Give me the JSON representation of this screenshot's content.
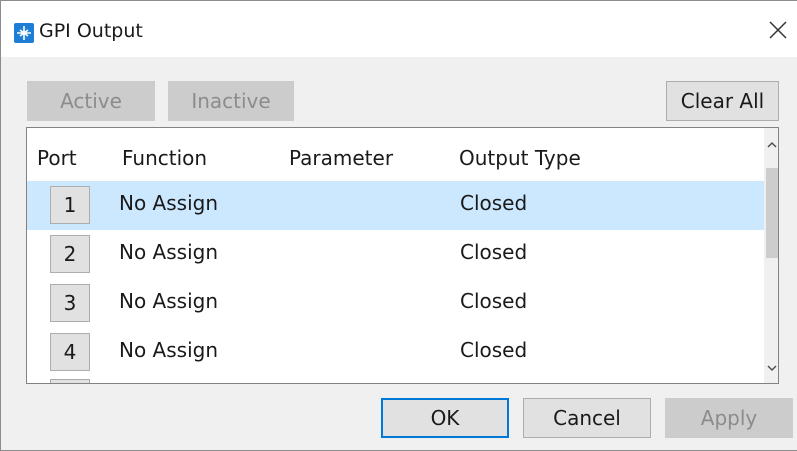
{
  "window": {
    "title": "GPI Output"
  },
  "toolbar": {
    "active_label": "Active",
    "inactive_label": "Inactive",
    "clear_all_label": "Clear All"
  },
  "table": {
    "headers": {
      "port": "Port",
      "function": "Function",
      "parameter": "Parameter",
      "output_type": "Output Type"
    },
    "rows": [
      {
        "port": "1",
        "function": "No Assign",
        "parameter": "",
        "output_type": "Closed",
        "selected": true
      },
      {
        "port": "2",
        "function": "No Assign",
        "parameter": "",
        "output_type": "Closed",
        "selected": false
      },
      {
        "port": "3",
        "function": "No Assign",
        "parameter": "",
        "output_type": "Closed",
        "selected": false
      },
      {
        "port": "4",
        "function": "No Assign",
        "parameter": "",
        "output_type": "Closed",
        "selected": false
      }
    ]
  },
  "footer": {
    "ok_label": "OK",
    "cancel_label": "Cancel",
    "apply_label": "Apply"
  },
  "colors": {
    "accent": "#0078d7",
    "selected_row": "#cce8ff",
    "disabled_text": "#8c8c8c"
  },
  "icons": {
    "app": "gpi-app-icon",
    "close": "close-icon",
    "scroll_up": "chevron-up-icon",
    "scroll_down": "chevron-down-icon"
  }
}
